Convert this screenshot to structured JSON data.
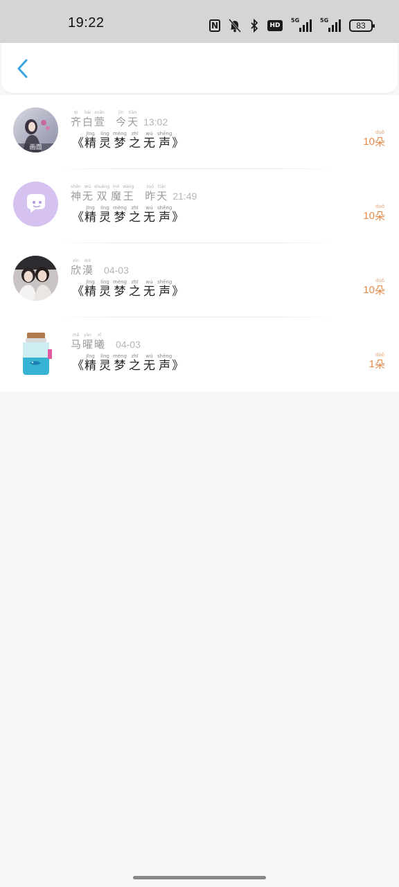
{
  "status_bar": {
    "time": "19:22",
    "nfc_label": "N",
    "hd_label": "HD",
    "signal1_tag": "5G",
    "signal2_tag": "5G",
    "battery": "83"
  },
  "header": {
    "back_icon": "chevron-left-icon",
    "accent": "#3aa3e3"
  },
  "flowers": [
    {
      "name": [
        {
          "hz": "齐",
          "py": "qí"
        },
        {
          "hz": "白",
          "py": "bái"
        },
        {
          "hz": "萱",
          "py": "xuān"
        }
      ],
      "day": [
        {
          "hz": "今",
          "py": "jīn"
        },
        {
          "hz": "天",
          "py": "tiān"
        }
      ],
      "time": "13:02",
      "title": [
        {
          "hz": "精",
          "py": "jīng"
        },
        {
          "hz": "灵",
          "py": "líng"
        },
        {
          "hz": "梦",
          "py": "mèng"
        },
        {
          "hz": "之",
          "py": "zhī"
        },
        {
          "hz": "无",
          "py": "wú"
        },
        {
          "hz": "声",
          "py": "shēng"
        }
      ],
      "count": "10",
      "unit": {
        "hz": "朵",
        "py": "duǒ"
      },
      "avatar": "photo-avatar-girl",
      "avatar_caption": "画面"
    },
    {
      "name": [
        {
          "hz": "神",
          "py": "shén"
        },
        {
          "hz": "无",
          "py": "wú"
        },
        {
          "hz": "双",
          "py": "shuāng"
        },
        {
          "hz": "魔",
          "py": "mó"
        },
        {
          "hz": "王",
          "py": "wáng"
        }
      ],
      "day": [
        {
          "hz": "昨",
          "py": "zuó"
        },
        {
          "hz": "天",
          "py": "tiān"
        }
      ],
      "time": "21:49",
      "title": [
        {
          "hz": "精",
          "py": "jīng"
        },
        {
          "hz": "灵",
          "py": "líng"
        },
        {
          "hz": "梦",
          "py": "mèng"
        },
        {
          "hz": "之",
          "py": "zhī"
        },
        {
          "hz": "无",
          "py": "wú"
        },
        {
          "hz": "声",
          "py": "shēng"
        }
      ],
      "count": "10",
      "unit": {
        "hz": "朵",
        "py": "duǒ"
      },
      "avatar": "default-chat-avatar"
    },
    {
      "name": [
        {
          "hz": "欣",
          "py": "xīn"
        },
        {
          "hz": "漠",
          "py": "mò"
        }
      ],
      "day": [],
      "time": "04-03",
      "title": [
        {
          "hz": "精",
          "py": "jīng"
        },
        {
          "hz": "灵",
          "py": "líng"
        },
        {
          "hz": "梦",
          "py": "mèng"
        },
        {
          "hz": "之",
          "py": "zhī"
        },
        {
          "hz": "无",
          "py": "wú"
        },
        {
          "hz": "声",
          "py": "shēng"
        }
      ],
      "count": "10",
      "unit": {
        "hz": "朵",
        "py": "duǒ"
      },
      "avatar": "photo-avatar-couple"
    },
    {
      "name": [
        {
          "hz": "马",
          "py": "mǎ"
        },
        {
          "hz": "曜",
          "py": "yào"
        },
        {
          "hz": "曦",
          "py": "xī"
        }
      ],
      "day": [],
      "time": "04-03",
      "title": [
        {
          "hz": "精",
          "py": "jīng"
        },
        {
          "hz": "灵",
          "py": "líng"
        },
        {
          "hz": "梦",
          "py": "mèng"
        },
        {
          "hz": "之",
          "py": "zhī"
        },
        {
          "hz": "无",
          "py": "wú"
        },
        {
          "hz": "声",
          "py": "shēng"
        }
      ],
      "count": "1",
      "unit": {
        "hz": "朵",
        "py": "duǒ"
      },
      "avatar": "bottle-avatar"
    }
  ],
  "title_brackets": {
    "open": "《",
    "close": "》"
  },
  "colors": {
    "flower_count": "#e88a4a",
    "background": "#f8f7f7",
    "status_bar": "#d5d5d5"
  }
}
